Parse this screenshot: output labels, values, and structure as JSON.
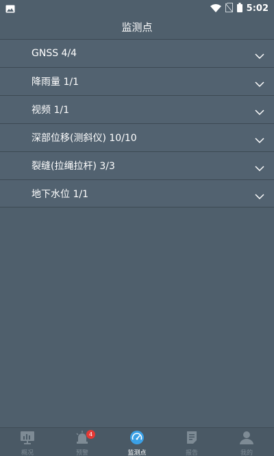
{
  "status_bar": {
    "time": "5:02",
    "icons": [
      "gallery-icon",
      "wifi-icon",
      "no-sim-icon",
      "battery-icon"
    ]
  },
  "header": {
    "title": "监测点"
  },
  "monitor_list": [
    {
      "label": "GNSS 4/4"
    },
    {
      "label": "降雨量 1/1"
    },
    {
      "label": "视频 1/1"
    },
    {
      "label": "深部位移(测斜仪) 10/10"
    },
    {
      "label": "裂缝(拉绳拉杆) 3/3"
    },
    {
      "label": "地下水位 1/1"
    }
  ],
  "bottom_nav": {
    "items": [
      {
        "label": "概况",
        "icon": "overview-icon"
      },
      {
        "label": "预警",
        "icon": "alarm-icon",
        "badge": "4"
      },
      {
        "label": "监测点",
        "icon": "monitor-gauge-icon",
        "active": true
      },
      {
        "label": "报告",
        "icon": "report-icon"
      },
      {
        "label": "我的",
        "icon": "profile-icon"
      }
    ]
  },
  "colors": {
    "background": "#4f5f6c",
    "row": "#526270",
    "active_accent": "#3aa0e6",
    "badge": "#e53935",
    "inactive_text": "#7e8b95"
  }
}
